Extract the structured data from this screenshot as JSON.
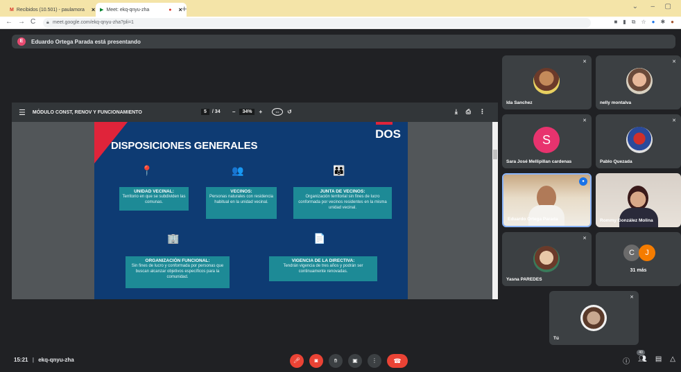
{
  "browser": {
    "tabs": [
      {
        "label": "Recibidos (10.501) - paulamora",
        "close": "×"
      },
      {
        "label": "Meet: ekq-qnyu-zha",
        "close": "×"
      }
    ],
    "new_tab": "+",
    "url": "meet.google.com/ekq-qnyu-zha?pli=1",
    "window_controls": [
      "⌄",
      "–",
      "▢"
    ]
  },
  "presenter": {
    "initial": "E",
    "text": "Eduardo Ortega Parada está presentando"
  },
  "pdf": {
    "title": "MÓDULO CONST, RENOV Y FUNCIONAMIENTO",
    "page_current": "5",
    "page_total": "/ 34",
    "zoom": "34%",
    "zoom_minus": "–",
    "zoom_plus": "+"
  },
  "slide": {
    "heading": "DISPOSICIONES GENERALES",
    "logo": "DOS",
    "cards": [
      {
        "title": "UNIDAD VECINAL:",
        "desc": "Territorio en que se subdividen las comunas."
      },
      {
        "title": "VECINOS:",
        "desc": "Personas naturales con residencia habitual en la unidad vecinal."
      },
      {
        "title": "JUNTA DE VECINOS:",
        "desc": "Organización territorial sin fines de lucro conformada por vecinos residentes en la misma unidad vecinal."
      },
      {
        "title": "ORGANIZACIÓN FUNCIONAL:",
        "desc": "Sin fines de lucro y conformada por personas que buscan alcanzar objetivos específicos para la comunidad."
      },
      {
        "title": "VIGENCIA DE LA DIRECTIVA:",
        "desc": "Tendrán vigencia de tres años y podrán ser continuamente renovadas."
      }
    ]
  },
  "participants": [
    {
      "name": "Ida Sanchez"
    },
    {
      "name": "nelly montalva"
    },
    {
      "name": "Sara José Mellipillan cardenas",
      "initial": "S"
    },
    {
      "name": "Pablo Quezada"
    },
    {
      "name": "Eduardo Ortega Parada"
    },
    {
      "name": "Rommy González Molina"
    },
    {
      "name": "Yasna PAREDES"
    },
    {
      "name": "31 más",
      "initials": [
        "C",
        "J"
      ]
    },
    {
      "name": "Tú"
    }
  ],
  "meeting": {
    "time": "15:21",
    "separator": "|",
    "code": "ekq-qnyu-zha",
    "participant_count": "40"
  },
  "colors": {
    "slide_bg": "#0e3b73",
    "card_bg": "#1d8a96",
    "accent_red": "#e0243a",
    "meet_bg": "#202124",
    "end_call": "#ea4335"
  }
}
